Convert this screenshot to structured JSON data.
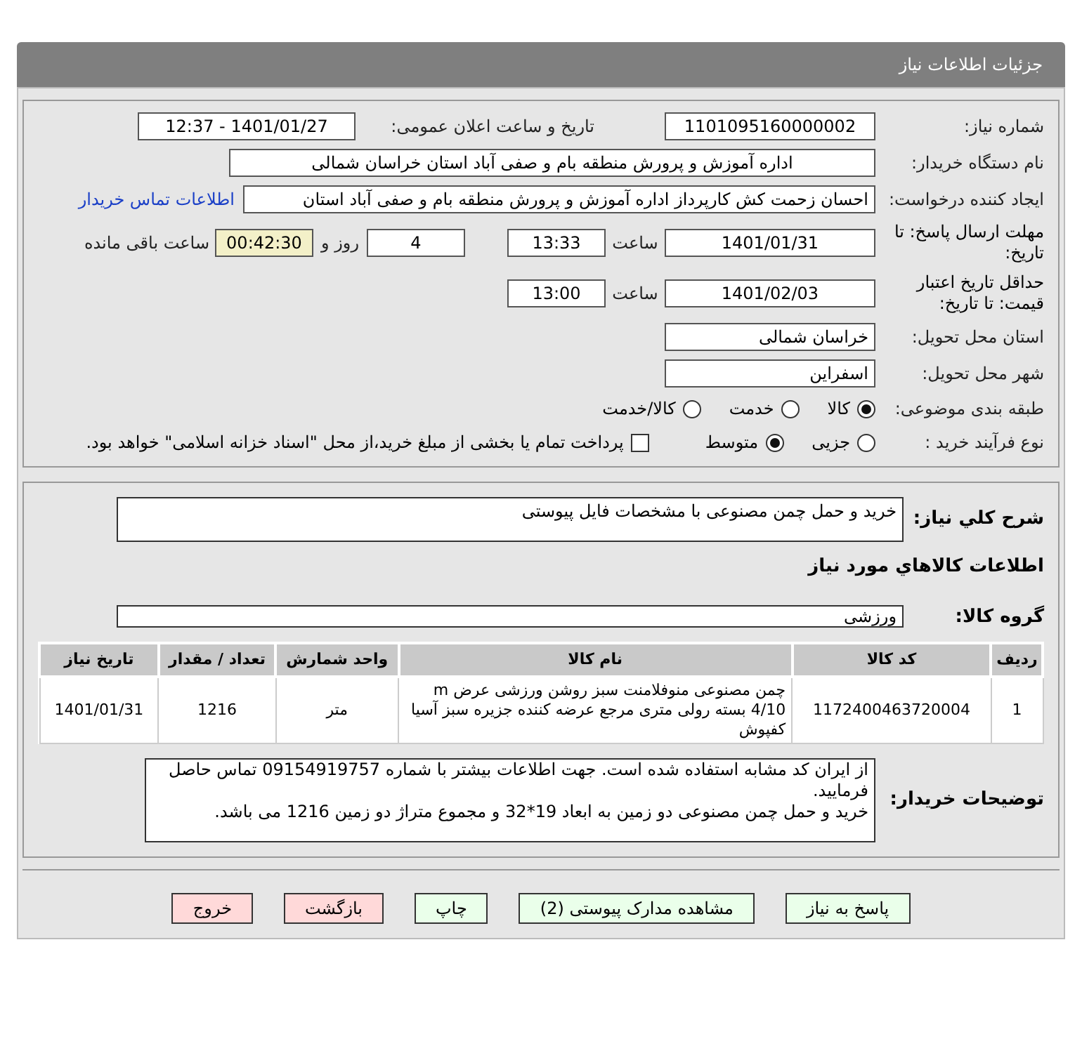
{
  "header": {
    "title": "جزئیات اطلاعات نیاز"
  },
  "details": {
    "need_number": {
      "label": "شماره نیاز:",
      "value": "1101095160000002"
    },
    "announce": {
      "label": "تاریخ و ساعت اعلان عمومی:",
      "value": "1401/01/27 - 12:37"
    },
    "buyer_org": {
      "label": "نام دستگاه خریدار:",
      "value": "اداره آموزش و پرورش منطقه بام و صفی آباد استان خراسان شمالی"
    },
    "requester": {
      "label": "ایجاد کننده درخواست:",
      "value": "احسان زحمت کش کارپرداز اداره آموزش و پرورش منطقه بام و صفی آباد استان",
      "link": "اطلاعات تماس خریدار"
    },
    "deadline": {
      "label": "مهلت ارسال پاسخ: تا تاریخ:",
      "date": "1401/01/31",
      "time_label": "ساعت",
      "time": "13:33",
      "days": "4",
      "days_label": "روز و",
      "remaining": "00:42:30",
      "remaining_label": "ساعت باقی مانده"
    },
    "validity": {
      "label": "حداقل تاریخ اعتبار قیمت: تا تاریخ:",
      "date": "1401/02/03",
      "time_label": "ساعت",
      "time": "13:00"
    },
    "province": {
      "label": "استان محل تحویل:",
      "value": "خراسان شمالی"
    },
    "city": {
      "label": "شهر محل تحویل:",
      "value": "اسفراین"
    },
    "category": {
      "label": "طبقه بندی موضوعی:",
      "options": [
        {
          "label": "کالا",
          "selected": true
        },
        {
          "label": "خدمت",
          "selected": false
        },
        {
          "label": "کالا/خدمت",
          "selected": false
        }
      ]
    },
    "process": {
      "label": "نوع فرآیند خرید :",
      "options": [
        {
          "label": "جزیی",
          "selected": false
        },
        {
          "label": "متوسط",
          "selected": true
        }
      ],
      "payment": {
        "checked": false,
        "label": "پرداخت تمام یا بخشی از مبلغ خرید،از محل \"اسناد خزانه اسلامی\" خواهد بود."
      }
    }
  },
  "summary": {
    "label": "شرح کلي نياز:",
    "value": "خرید و حمل چمن مصنوعی با مشخصات فایل پیوستی"
  },
  "goods_title": "اطلاعات کالاهاي مورد نياز",
  "goods_group": {
    "label": "گروه کالا:",
    "value": "ورزشی"
  },
  "table": {
    "columns": [
      "ردیف",
      "کد کالا",
      "نام کالا",
      "واحد شمارش",
      "تعداد / مقدار",
      "تاریخ نیاز"
    ],
    "rows": [
      [
        "1",
        "1172400463720004",
        "چمن مصنوعی منوفلامنت سبز روشن ورزشی عرض m 4/10 بسته رولی متری مرجع عرضه کننده جزیره سبز آسیا کفپوش",
        "متر",
        "1216",
        "1401/01/31"
      ]
    ]
  },
  "buyer_notes": {
    "label": "توضیحات خریدار:",
    "value": "از ایران کد مشابه استفاده شده است. جهت اطلاعات بیشتر با شماره 09154919757 تماس حاصل فرمایید.\nخرید و حمل چمن مصنوعی دو زمین به ابعاد 19*32 و مجموع متراژ دو زمین 1216 می باشد."
  },
  "buttons": [
    {
      "label": "پاسخ به نیاز",
      "kind": "action"
    },
    {
      "label": "مشاهده مدارک پیوستی (2)",
      "kind": "action"
    },
    {
      "label": "چاپ",
      "kind": "action"
    },
    {
      "label": "بازگشت",
      "kind": "exit"
    },
    {
      "label": "خروج",
      "kind": "exit"
    }
  ]
}
